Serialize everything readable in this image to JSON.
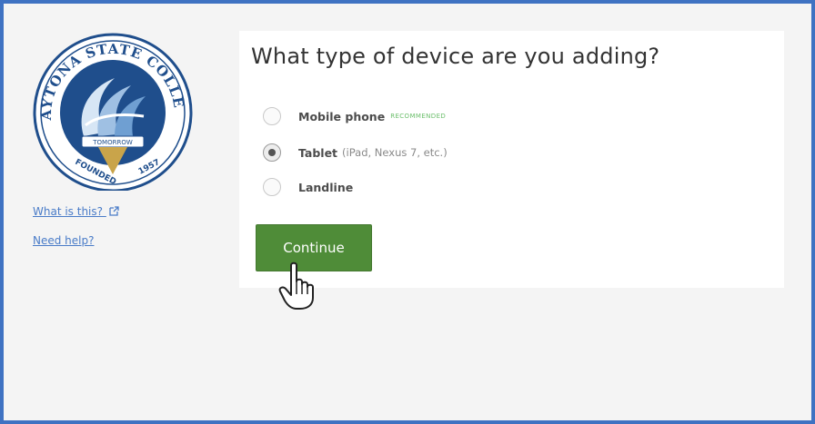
{
  "logo": {
    "arc_top": "DAYTONA STATE COLLEGE",
    "banner": "TOMORROW",
    "founded": "FOUNDED",
    "year": "1957",
    "colors": {
      "navy": "#1f4e8c",
      "gold": "#c9a44a",
      "light_blue": "#8fb2d8"
    }
  },
  "sidebar": {
    "what_is_this": "What is this?",
    "what_is_this_icon": "external-link-icon",
    "need_help": "Need help?"
  },
  "prompt": {
    "title": "What type of device are you adding?",
    "options": [
      {
        "label": "Mobile phone",
        "note": "",
        "badge": "RECOMMENDED",
        "checked": false
      },
      {
        "label": "Tablet",
        "note": "(iPad, Nexus 7, etc.)",
        "badge": "",
        "checked": true
      },
      {
        "label": "Landline",
        "note": "",
        "badge": "",
        "checked": false
      }
    ],
    "continue_label": "Continue"
  },
  "cursor": {
    "icon": "hand-pointer-icon"
  },
  "colors": {
    "frame_border": "#3f72c2",
    "button_green": "#4f8c38",
    "link_blue": "#4a7cc8",
    "badge_green": "#6cbf6c"
  }
}
